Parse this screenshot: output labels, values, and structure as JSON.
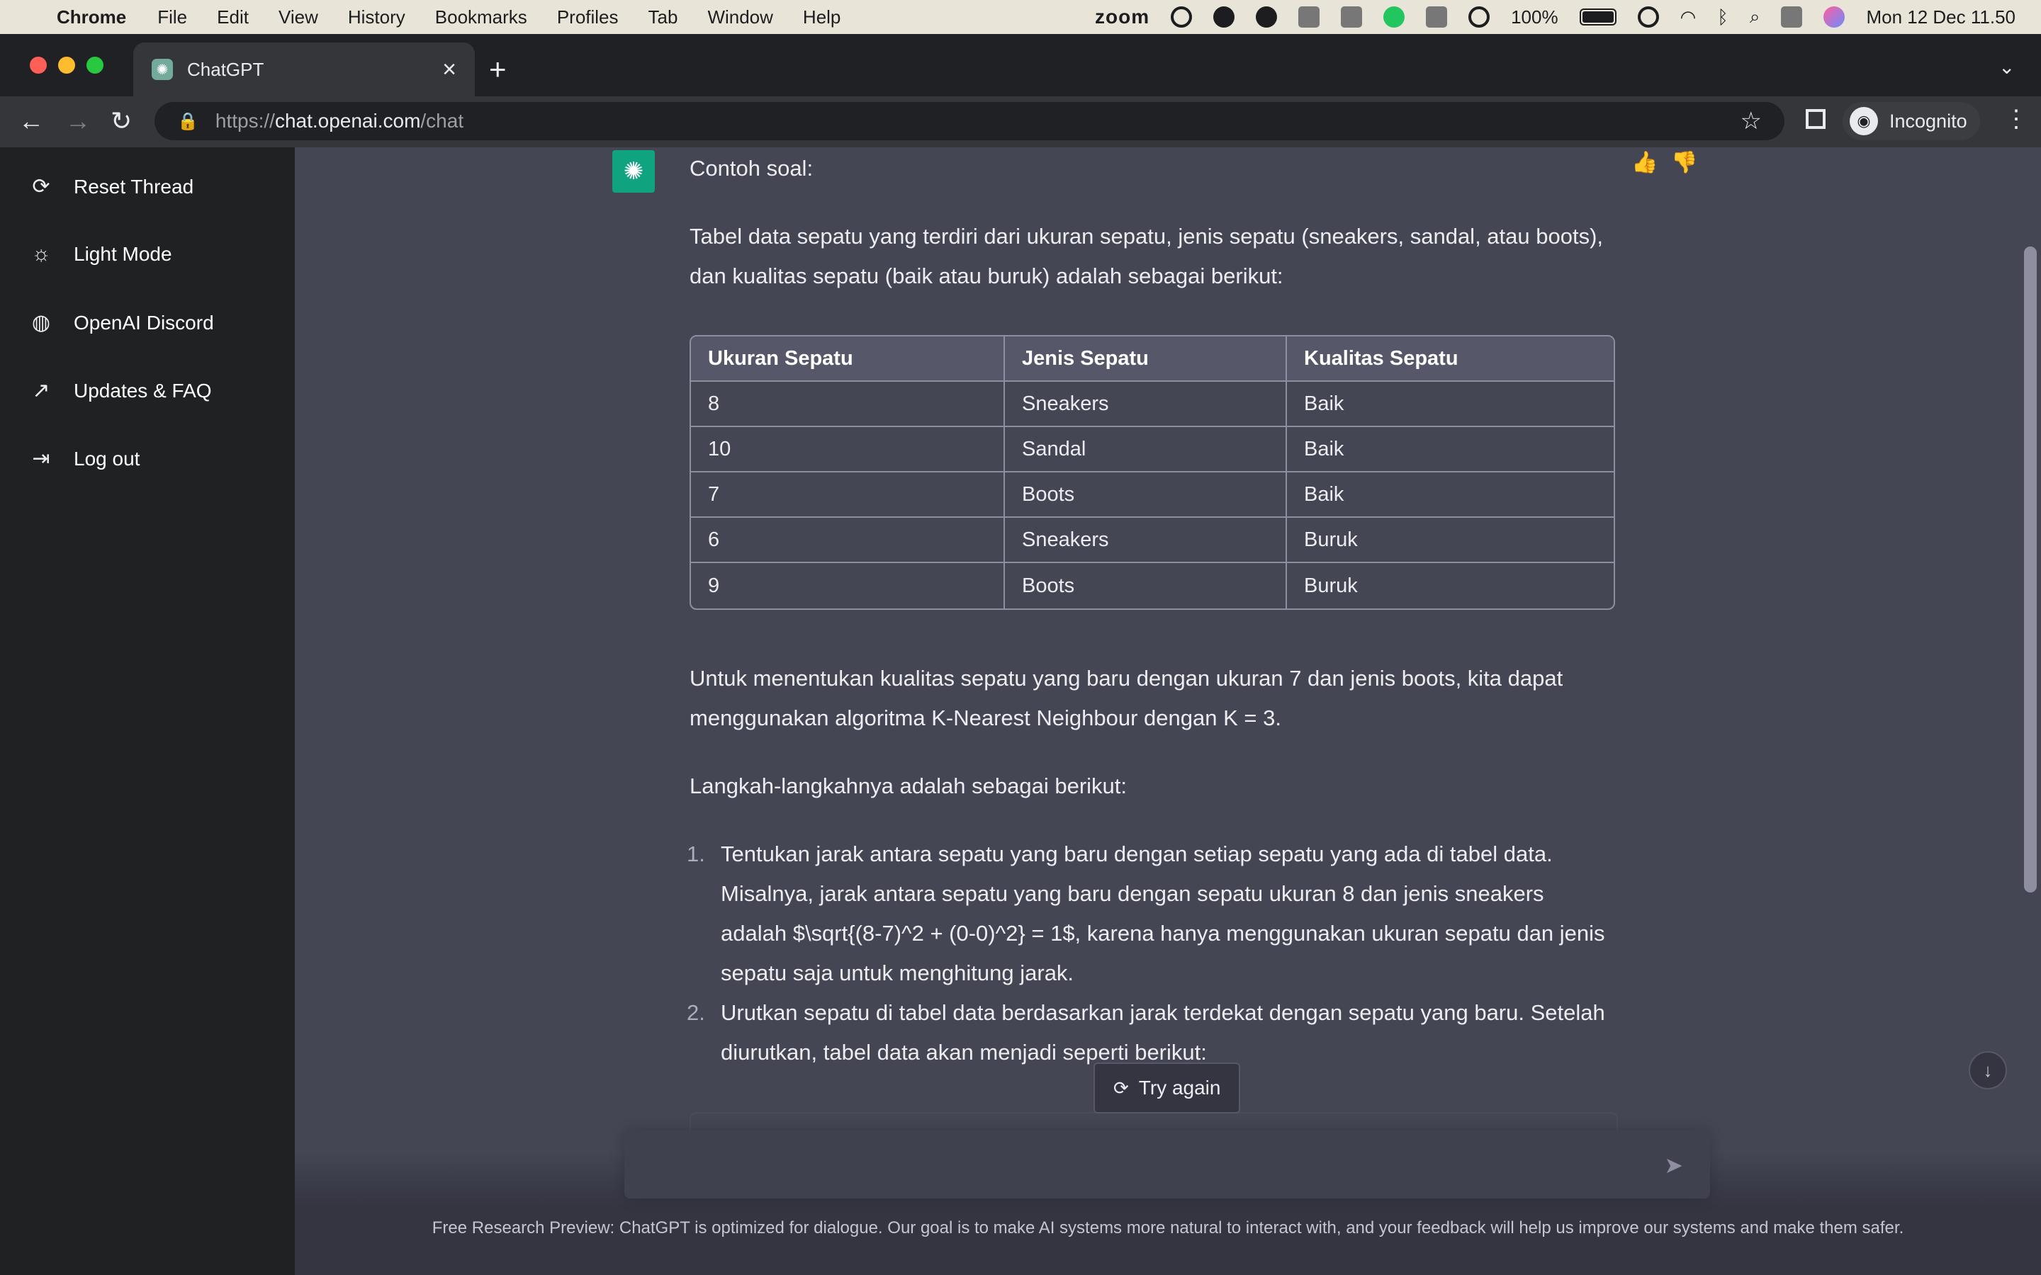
{
  "menubar": {
    "app": "Chrome",
    "items": [
      "File",
      "Edit",
      "View",
      "History",
      "Bookmarks",
      "Profiles",
      "Tab",
      "Window",
      "Help"
    ],
    "zoom": "zoom",
    "battery": "100%",
    "datetime": "Mon 12 Dec  11.50"
  },
  "browser": {
    "tab_title": "ChatGPT",
    "url_scheme": "https://",
    "url_host": "chat.openai.com",
    "url_path": "/chat",
    "profile": "Incognito"
  },
  "sidebar": {
    "items": [
      {
        "label": "Reset Thread",
        "icon": "refresh-icon"
      },
      {
        "label": "Light Mode",
        "icon": "sun-icon"
      },
      {
        "label": "OpenAI Discord",
        "icon": "discord-icon"
      },
      {
        "label": "Updates & FAQ",
        "icon": "external-link-icon"
      },
      {
        "label": "Log out",
        "icon": "logout-icon"
      }
    ]
  },
  "message": {
    "heading": "Contoh soal:",
    "intro": "Tabel data sepatu yang terdiri dari ukuran sepatu, jenis sepatu (sneakers, sandal, atau boots), dan kualitas sepatu (baik atau buruk) adalah sebagai berikut:",
    "table": {
      "headers": [
        "Ukuran Sepatu",
        "Jenis Sepatu",
        "Kualitas Sepatu"
      ],
      "rows": [
        [
          "8",
          "Sneakers",
          "Baik"
        ],
        [
          "10",
          "Sandal",
          "Baik"
        ],
        [
          "7",
          "Boots",
          "Baik"
        ],
        [
          "6",
          "Sneakers",
          "Buruk"
        ],
        [
          "9",
          "Boots",
          "Buruk"
        ]
      ]
    },
    "para2": "Untuk menentukan kualitas sepatu yang baru dengan ukuran 7 dan jenis boots, kita dapat menggunakan algoritma K-Nearest Neighbour dengan K = 3.",
    "para3": "Langkah-langkahnya adalah sebagai berikut:",
    "steps": [
      {
        "num": "1.",
        "text": "Tentukan jarak antara sepatu yang baru dengan setiap sepatu yang ada di tabel data. Misalnya, jarak antara sepatu yang baru dengan sepatu ukuran 8 dan jenis sneakers adalah $\\sqrt{(8-7)^2 + (0-0)^2} = 1$, karena hanya menggunakan ukuran sepatu dan jenis sepatu saja untuk menghitung jarak."
      },
      {
        "num": "2.",
        "text": "Urutkan sepatu di tabel data berdasarkan jarak terdekat dengan sepatu yang baru. Setelah diurutkan, tabel data akan menjadi seperti berikut:"
      }
    ]
  },
  "controls": {
    "try_again": "Try again",
    "footer": "Free Research Preview: ChatGPT is optimized for dialogue. Our goal is to make AI systems more natural to interact with, and your feedback will help us improve our systems and make them safer."
  }
}
